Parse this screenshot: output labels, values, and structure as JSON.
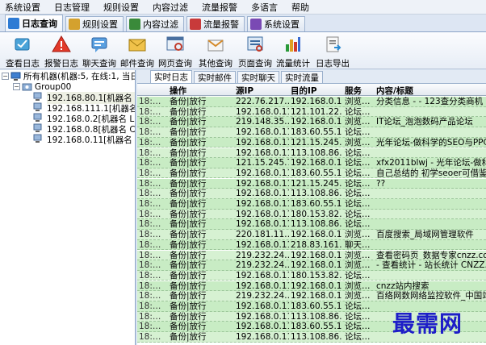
{
  "menu": [
    "系统设置",
    "日志管理",
    "规则设置",
    "内容过滤",
    "流量报警",
    "多语言",
    "帮助"
  ],
  "main_tabs": [
    {
      "label": "日志查询",
      "icon": "log-query-icon",
      "color": "#2e7bd4",
      "active": true
    },
    {
      "label": "规则设置",
      "icon": "rules-icon",
      "color": "#d4a12e",
      "active": false
    },
    {
      "label": "内容过滤",
      "icon": "filter-icon",
      "color": "#3a8a3a",
      "active": false
    },
    {
      "label": "流量报警",
      "icon": "traffic-alarm-icon",
      "color": "#c83a3a",
      "active": false
    },
    {
      "label": "系统设置",
      "icon": "settings-icon",
      "color": "#7a4ab4",
      "active": false
    }
  ],
  "toolbar": [
    {
      "label": "查看日志",
      "icon": "view-log-icon"
    },
    {
      "label": "报警日志",
      "icon": "alarm-log-icon"
    },
    {
      "label": "聊天查询",
      "icon": "chat-query-icon"
    },
    {
      "label": "邮件查询",
      "icon": "mail-query-icon"
    },
    {
      "label": "网页查询",
      "icon": "web-query-icon"
    },
    {
      "label": "其他查询",
      "icon": "other-query-icon"
    },
    {
      "label": "页面查询",
      "icon": "page-query-icon"
    },
    {
      "label": "流量统计",
      "icon": "traffic-stats-icon"
    },
    {
      "label": "日志导出",
      "icon": "log-export-icon"
    }
  ],
  "tree": {
    "root": "所有机器(机器:5, 在线:1, 当日…",
    "group": "Group00",
    "machines": [
      "192.168.80.1[机器名 PC",
      "192.168.111.1[机器名 ",
      "192.168.0.2[机器名 LE",
      "192.168.0.8[机器名 CM",
      "192.168.0.11[机器名 PC"
    ]
  },
  "sub_tabs": [
    "实时日志",
    "实时邮件",
    "实时聊天",
    "实时流量"
  ],
  "grid": {
    "headers": [
      "",
      "操作",
      "源IP",
      "目的IP",
      "服务",
      "内容/标题"
    ],
    "rows": [
      [
        "18:…",
        "备份|放行",
        "222.76.217…",
        "192.168.0.11",
        "浏览…",
        "分类信息 - - 123查分类商机"
      ],
      [
        "18:…",
        "备份|放行",
        "192.168.0.11",
        "121.101.22…",
        "论坛…",
        ""
      ],
      [
        "18:…",
        "备份|放行",
        "219.148.35…",
        "192.168.0.11",
        "浏览…",
        "IT论坛_泡泡数码产品论坛"
      ],
      [
        "18:…",
        "备份|放行",
        "192.168.0.11",
        "183.60.55.17",
        "论坛…",
        ""
      ],
      [
        "18:…",
        "备份|放行",
        "192.168.0.11",
        "121.15.245.7",
        "浏览…",
        "光年论坛-做科学的SEO与PPC -"
      ],
      [
        "18:…",
        "备份|放行",
        "192.168.0.11",
        "113.108.86…",
        "论坛…",
        ""
      ],
      [
        "18:…",
        "备份|放行",
        "121.15.245.7",
        "192.168.0.11",
        "论坛…",
        "xfx2011blwj - 光年论坛-做科学"
      ],
      [
        "18:…",
        "备份|放行",
        "192.168.0.11",
        "183.60.55.17",
        "论坛…",
        "自己总结的 初学seoer可借鉴 -"
      ],
      [
        "18:…",
        "备份|放行",
        "192.168.0.11",
        "121.15.245.7",
        "论坛…",
        "??"
      ],
      [
        "18:…",
        "备份|放行",
        "192.168.0.11",
        "113.108.86…",
        "论坛…",
        ""
      ],
      [
        "18:…",
        "备份|放行",
        "192.168.0.11",
        "183.60.55.17",
        "论坛…",
        ""
      ],
      [
        "18:…",
        "备份|放行",
        "192.168.0.11",
        "180.153.82…",
        "论坛…",
        ""
      ],
      [
        "18:…",
        "备份|放行",
        "192.168.0.11",
        "113.108.86…",
        "论坛…",
        ""
      ],
      [
        "18:…",
        "备份|放行",
        "220.181.11…",
        "192.168.0.11",
        "浏览…",
        "百度搜索_局域网管理软件"
      ],
      [
        "18:…",
        "备份|放行",
        "192.168.0.11",
        "218.83.161…",
        "聊天…",
        ""
      ],
      [
        "18:…",
        "备份|放行",
        "219.232.24…",
        "192.168.0.11",
        "浏览…",
        "查看密码页_数据专家cnzz.com"
      ],
      [
        "18:…",
        "备份|放行",
        "219.232.24…",
        "192.168.0.11",
        "浏览…",
        " - 查看统计 - 站长统计 CNZZ.com"
      ],
      [
        "18:…",
        "备份|放行",
        "192.168.0.11",
        "180.153.82…",
        "论坛…",
        ""
      ],
      [
        "18:…",
        "备份|放行",
        "192.168.0.11",
        "192.168.0.11",
        "浏览…",
        "cnzz站内搜索"
      ],
      [
        "18:…",
        "备份|放行",
        "219.232.24…",
        "192.168.0.11",
        "浏览…",
        "百络网数网络监控软件_中国站"
      ],
      [
        "18:…",
        "备份|放行",
        "192.168.0.11",
        "183.60.55.17",
        "论坛…",
        ""
      ],
      [
        "18:…",
        "备份|放行",
        "192.168.0.11",
        "113.108.86…",
        "论坛…",
        ""
      ],
      [
        "18:…",
        "备份|放行",
        "192.168.0.11",
        "183.60.55.17",
        "论坛…",
        ""
      ],
      [
        "18:…",
        "备份|放行",
        "192.168.0.11",
        "113.108.86…",
        "论坛…",
        ""
      ]
    ]
  },
  "watermark": "最需网"
}
